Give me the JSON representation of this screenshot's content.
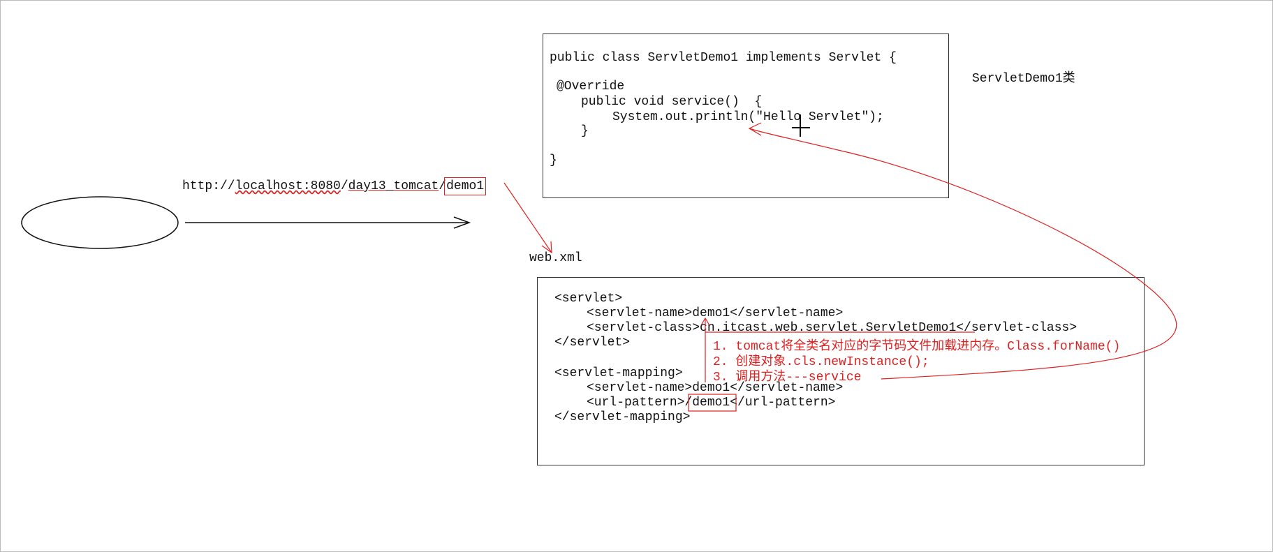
{
  "class_box": {
    "lines": [
      "public class ServletDemo1 implements Servlet {",
      "@Override",
      "public void service()  {",
      "System.out.println(\"Hello Servlet\");",
      "}",
      "}"
    ],
    "label": "ServletDemo1类"
  },
  "url": {
    "prefix": "http://",
    "host": "localhost:8080",
    "sep1": "/",
    "context": "day13_tomcat",
    "sep2": "/",
    "path": "demo1"
  },
  "webxml_label": "web.xml",
  "xml_box": {
    "lines": [
      "<servlet>",
      "<servlet-name>demo1</servlet-name>",
      "<servlet-class>cn.itcast.web.servlet.ServletDemo1</servlet-class>",
      "</servlet>",
      "<servlet-mapping>",
      "<servlet-name>demo1</servlet-name>",
      "<url-pattern>/demo1</url-pattern>",
      "</servlet-mapping>"
    ],
    "notes": [
      "1. tomcat将全类名对应的字节码文件加载进内存。Class.forName()",
      "2. 创建对象.cls.newInstance();",
      "3. 调用方法---service"
    ]
  },
  "colors": {
    "annotation": "#e02020",
    "ink": "#111111"
  }
}
